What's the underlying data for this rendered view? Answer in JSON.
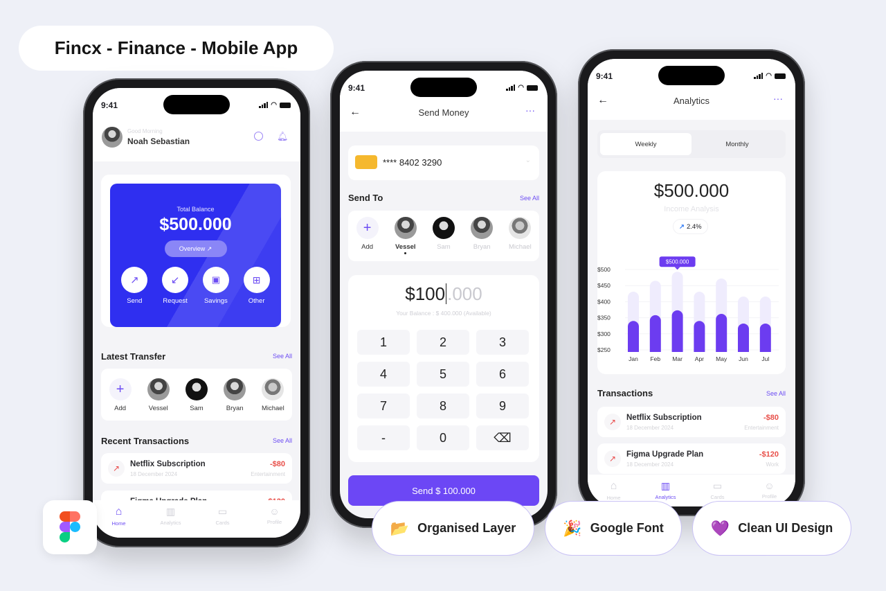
{
  "title": "Fincx - Finance - Mobile App",
  "badges": [
    {
      "icon": "folder-icon",
      "emoji": "📂",
      "label": "Organised Layer"
    },
    {
      "icon": "party-popper-icon",
      "emoji": "🎉",
      "label": "Google Font"
    },
    {
      "icon": "purple-heart-icon",
      "emoji": "💜",
      "label": "Clean UI Design"
    }
  ],
  "colors": {
    "accent": "#6c4cf3",
    "card_blue": "#3434f0",
    "negative": "#e8504a",
    "background": "#eef0f7"
  },
  "status_time": "9:41",
  "home": {
    "greeting": "Good Morning",
    "user_name": "Noah Sebastian",
    "balance_label": "Total Balance",
    "balance": "$500.000",
    "overview_label": "Overview ↗",
    "actions": [
      {
        "label": "Send",
        "icon": "arrow-up-right-icon"
      },
      {
        "label": "Request",
        "icon": "arrow-down-left-icon"
      },
      {
        "label": "Savings",
        "icon": "wallet-icon"
      },
      {
        "label": "Other",
        "icon": "grid-icon"
      }
    ],
    "latest_transfer_title": "Latest Transfer",
    "see_all": "See All",
    "contacts": [
      "Add",
      "Vessel",
      "Sam",
      "Bryan",
      "Michael"
    ],
    "recent_title": "Recent Transactions",
    "transactions": [
      {
        "name": "Netflix Subscription",
        "date": "18 December 2024",
        "amount": "-$80",
        "category": "Entertainment"
      },
      {
        "name": "Figma Upgrade Plan",
        "amount": "-$120"
      }
    ],
    "nav": [
      {
        "label": "Home",
        "active": true
      },
      {
        "label": "Analytics"
      },
      {
        "label": "Cards"
      },
      {
        "label": "Profile"
      }
    ]
  },
  "send": {
    "title": "Send Money",
    "card_number": "**** 8402 3290",
    "send_to_title": "Send To",
    "see_all": "See All",
    "contacts": [
      "Add",
      "Vessel",
      "Sam",
      "Bryan",
      "Michael"
    ],
    "selected_contact": "Vessel",
    "amount_main": "$100",
    "amount_decimal": ".000",
    "balance_note": "Your Balance : $ 400.000 (Available)",
    "keys": [
      "1",
      "2",
      "3",
      "4",
      "5",
      "6",
      "7",
      "8",
      "9",
      "-",
      "0",
      "⌫"
    ],
    "send_button": "Send $ 100.000"
  },
  "analytics": {
    "title": "Analytics",
    "tabs": [
      {
        "label": "Weekly",
        "active": true
      },
      {
        "label": "Monthly"
      }
    ],
    "amount": "$500.000",
    "subtitle": "Income Analysis",
    "change": "2.4%",
    "transactions_title": "Transactions",
    "see_all": "See All",
    "transactions": [
      {
        "name": "Netflix Subscription",
        "date": "18 December 2024",
        "amount": "-$80",
        "category": "Entertainment"
      },
      {
        "name": "Figma Upgrade Plan",
        "date": "18 December 2024",
        "amount": "-$120",
        "category": "Work"
      }
    ],
    "nav": [
      {
        "label": "Home"
      },
      {
        "label": "Analytics",
        "active": true
      },
      {
        "label": "Cards"
      },
      {
        "label": "Profile"
      }
    ]
  },
  "chart_data": {
    "type": "bar",
    "categories": [
      "Jan",
      "Feb",
      "Mar",
      "Apr",
      "May",
      "Jun",
      "Jul"
    ],
    "series": [
      {
        "values": [
          340,
          358,
          373,
          340,
          362,
          332,
          332
        ],
        "color": "#6c3cf0"
      },
      {
        "values": [
          431,
          465,
          493,
          431,
          472,
          416,
          416
        ],
        "color": "#efecfd"
      }
    ],
    "y_ticks": [
      "$500",
      "$450",
      "$400",
      "$350",
      "$300",
      "$250"
    ],
    "ylim": [
      250,
      500
    ],
    "tooltip": {
      "category": "Mar",
      "label": "$500.000"
    },
    "grid": true
  }
}
